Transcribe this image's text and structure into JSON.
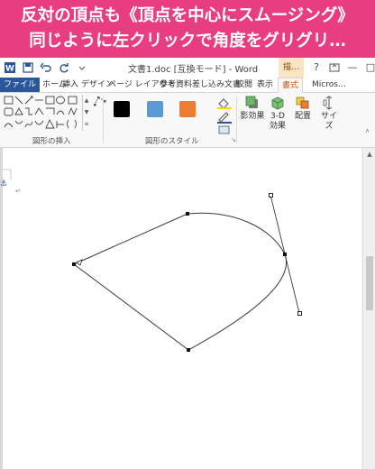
{
  "caption": {
    "line1": "反対の頂点も《頂点を中心にスムージング》",
    "line2": "同じように左クリックで角度をグリグリ…"
  },
  "window": {
    "doc_title": "文書1.doc [互換モード] - Word",
    "context_group_label": "描…",
    "user_label": "Micros…",
    "help_glyph": "?",
    "minimize_glyph": "—",
    "restore_glyph": "□"
  },
  "tabs": [
    {
      "label": "ファイル"
    },
    {
      "label": "ホーム"
    },
    {
      "label": "挿入"
    },
    {
      "label": "デザイン"
    },
    {
      "label": "ページ レイアウト"
    },
    {
      "label": "参考資料"
    },
    {
      "label": "差し込み文書"
    },
    {
      "label": "校閲"
    },
    {
      "label": "表示"
    },
    {
      "label": "書式"
    }
  ],
  "ribbon": {
    "insert_shapes_label": "図形の挿入",
    "shape_styles_label": "図形のスタイル",
    "shadow_label": "影効果",
    "threed_label_1": "3-D",
    "threed_label_2": "効果",
    "arrange_label": "配置",
    "size_label": "サイズ",
    "dropdown_glyph": "▾",
    "launcher_glyph": "↘",
    "scroll_up_glyph": "▲",
    "scroll_down_glyph": "▼",
    "more_glyph": "≡",
    "swatches": [
      {
        "name": "black",
        "color": "#000000"
      },
      {
        "name": "blue",
        "color": "#5b9bd5"
      },
      {
        "name": "orange",
        "color": "#ed7d31"
      }
    ]
  },
  "document": {
    "anchor_glyph": "⚓",
    "paragraph_mark": "↵"
  }
}
